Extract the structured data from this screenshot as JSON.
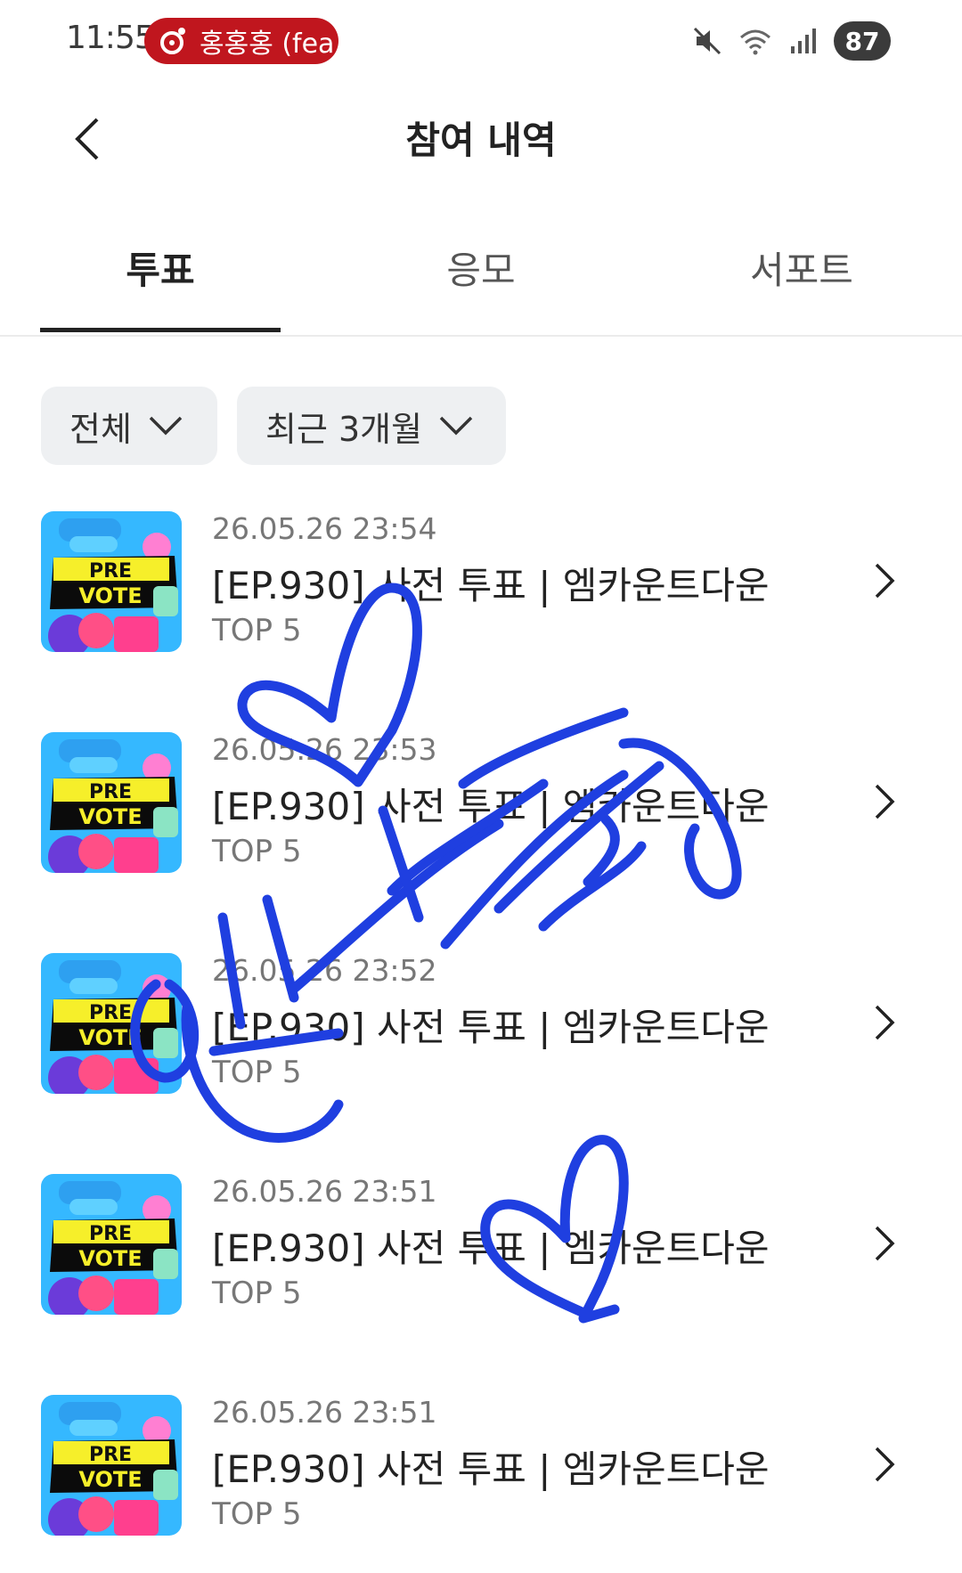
{
  "status_bar": {
    "time": "11:55",
    "media_text": "홍홍홍 (fea",
    "battery": "87",
    "icons": [
      "mute-icon",
      "wifi-icon",
      "signal-icon"
    ]
  },
  "header": {
    "title": "참여 내역",
    "back_icon": "chevron-left-icon"
  },
  "tabs": [
    {
      "label": "투표",
      "active": true
    },
    {
      "label": "응모",
      "active": false
    },
    {
      "label": "서포트",
      "active": false
    }
  ],
  "filters": {
    "category": "전체",
    "period": "최근 3개월"
  },
  "items": [
    {
      "date": "26.05.26 23:54",
      "title": "[EP.930] 사전 투표 | 엠카운트다운",
      "subtitle": "TOP 5",
      "thumb_top": "PRE",
      "thumb_bottom": "VOTE"
    },
    {
      "date": "26.05.26 23:53",
      "title": "[EP.930] 사전 투표 | 엠카운트다운",
      "subtitle": "TOP 5",
      "thumb_top": "PRE",
      "thumb_bottom": "VOTE"
    },
    {
      "date": "26.05.26 23:52",
      "title": "[EP.930] 사전 투표 | 엠카운트다운",
      "subtitle": "TOP 5",
      "thumb_top": "PRE",
      "thumb_bottom": "VOTE"
    },
    {
      "date": "26.05.26 23:51",
      "title": "[EP.930] 사전 투표 | 엠카운트다운",
      "subtitle": "TOP 5",
      "thumb_top": "PRE",
      "thumb_bottom": "VOTE"
    },
    {
      "date": "26.05.26 23:51",
      "title": "[EP.930] 사전 투표 | 엠카운트다운",
      "subtitle": "TOP 5",
      "thumb_top": "PRE",
      "thumb_bottom": "VOTE"
    }
  ],
  "colors": {
    "accent_red": "#c0161e",
    "scribble_blue": "#1f3fe0",
    "thumb_bg": "#35b8ff",
    "thumb_yellow": "#f6ef2a"
  }
}
